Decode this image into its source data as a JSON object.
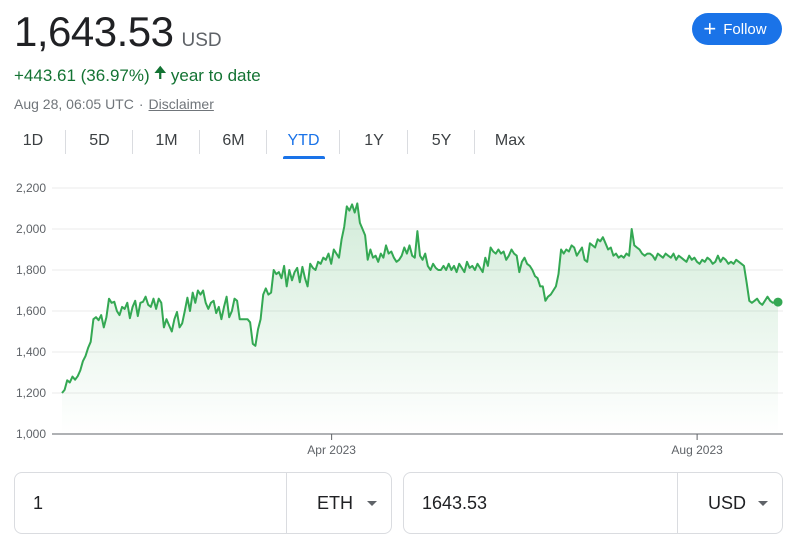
{
  "header": {
    "price": "1,643.53",
    "currency": "USD",
    "change": "+443.61 (36.97%)",
    "change_period": "year to date",
    "timestamp": "Aug 28, 06:05 UTC",
    "separator": "·",
    "disclaimer": "Disclaimer",
    "follow_label": "Follow",
    "up_color": "#137333",
    "accent_color": "#1a73e8"
  },
  "tabs": [
    {
      "label": "1D",
      "active": false
    },
    {
      "label": "5D",
      "active": false
    },
    {
      "label": "1M",
      "active": false
    },
    {
      "label": "6M",
      "active": false
    },
    {
      "label": "YTD",
      "active": true
    },
    {
      "label": "1Y",
      "active": false
    },
    {
      "label": "5Y",
      "active": false
    },
    {
      "label": "Max",
      "active": false
    }
  ],
  "chart_data": {
    "type": "area",
    "ylim": [
      1000,
      2200
    ],
    "yticks": [
      1000,
      1200,
      1400,
      1600,
      1800,
      2000,
      2200
    ],
    "ytick_labels": [
      "1,000",
      "1,200",
      "1,400",
      "1,600",
      "1,800",
      "2,000",
      "2,200"
    ],
    "xtick_labels": [
      "Apr 2023",
      "Aug 2023"
    ],
    "xtick_positions": [
      "2023-04-01",
      "2023-08-01"
    ],
    "start_date": "2023-01-01",
    "end_date": "2023-08-28",
    "grid": true,
    "line_color": "#34a853",
    "series": [
      {
        "name": "ETH",
        "values": [
          1200,
          1215,
          1262,
          1251,
          1280,
          1265,
          1282,
          1310,
          1355,
          1380,
          1420,
          1450,
          1560,
          1570,
          1555,
          1580,
          1520,
          1570,
          1660,
          1640,
          1645,
          1600,
          1580,
          1620,
          1610,
          1640,
          1565,
          1620,
          1650,
          1575,
          1640,
          1645,
          1670,
          1630,
          1620,
          1660,
          1610,
          1660,
          1640,
          1520,
          1560,
          1530,
          1500,
          1560,
          1595,
          1520,
          1540,
          1600,
          1665,
          1600,
          1690,
          1640,
          1700,
          1680,
          1700,
          1640,
          1610,
          1640,
          1650,
          1590,
          1620,
          1560,
          1620,
          1670,
          1570,
          1600,
          1660,
          1650,
          1560,
          1560,
          1560,
          1560,
          1545,
          1440,
          1430,
          1510,
          1560,
          1680,
          1710,
          1680,
          1690,
          1800,
          1780,
          1790,
          1760,
          1820,
          1720,
          1800,
          1750,
          1790,
          1810,
          1740,
          1815,
          1760,
          1720,
          1830,
          1810,
          1800,
          1840,
          1830,
          1860,
          1850,
          1880,
          1830,
          1900,
          1880,
          1860,
          1950,
          2010,
          2110,
          2090,
          2120,
          2080,
          2125,
          2030,
          2000,
          1970,
          1850,
          1900,
          1860,
          1870,
          1840,
          1880,
          1860,
          1920,
          1880,
          1890,
          1860,
          1840,
          1850,
          1870,
          1910,
          1880,
          1920,
          1870,
          1860,
          1990,
          1870,
          1850,
          1880,
          1820,
          1800,
          1830,
          1810,
          1800,
          1800,
          1820,
          1800,
          1830,
          1800,
          1820,
          1790,
          1830,
          1810,
          1790,
          1840,
          1810,
          1820,
          1800,
          1830,
          1810,
          1790,
          1860,
          1820,
          1910,
          1890,
          1880,
          1900,
          1880,
          1890,
          1850,
          1870,
          1900,
          1880,
          1870,
          1790,
          1840,
          1860,
          1830,
          1820,
          1800,
          1770,
          1760,
          1720,
          1720,
          1650,
          1670,
          1680,
          1700,
          1720,
          1780,
          1900,
          1880,
          1900,
          1890,
          1920,
          1910,
          1870,
          1890,
          1910,
          1850,
          1840,
          1930,
          1920,
          1910,
          1950,
          1940,
          1960,
          1930,
          1900,
          1910,
          1870,
          1880,
          1860,
          1870,
          1860,
          1880,
          1870,
          2000,
          1920,
          1910,
          1900,
          1880,
          1870,
          1880,
          1880,
          1870,
          1850,
          1880,
          1870,
          1860,
          1880,
          1870,
          1860,
          1880,
          1850,
          1870,
          1860,
          1850,
          1840,
          1870,
          1850,
          1860,
          1840,
          1830,
          1850,
          1840,
          1860,
          1850,
          1830,
          1840,
          1870,
          1840,
          1860,
          1850,
          1830,
          1840,
          1830,
          1850,
          1840,
          1830,
          1820,
          1740,
          1650,
          1640,
          1650,
          1660,
          1640,
          1630,
          1650,
          1670,
          1650,
          1640,
          1645,
          1643.53
        ]
      }
    ]
  },
  "converter": {
    "from_value": "1",
    "from_currency": "ETH",
    "to_value": "1643.53",
    "to_currency": "USD"
  }
}
